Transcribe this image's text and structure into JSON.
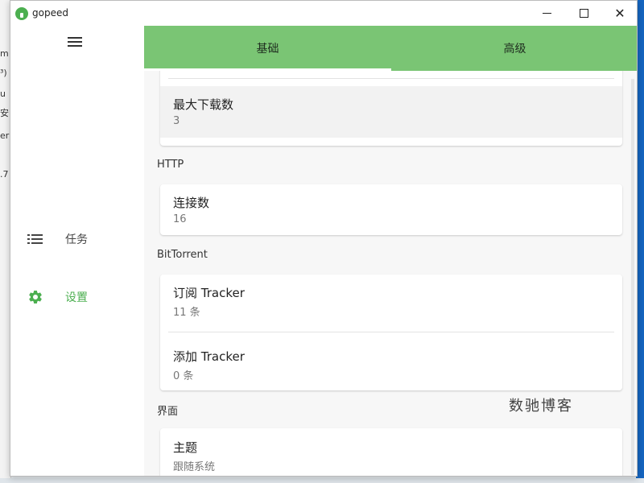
{
  "window": {
    "title": "gopeed"
  },
  "background": {
    "fragments": [
      "m",
      "³)",
      "u",
      "安",
      "er",
      ".7"
    ]
  },
  "sidebar": {
    "items": [
      {
        "label": "任务",
        "icon": "list-icon"
      },
      {
        "label": "设置",
        "icon": "gear-icon",
        "active": true
      }
    ]
  },
  "tabs": [
    {
      "label": "基础",
      "active": true
    },
    {
      "label": "高级",
      "active": false
    }
  ],
  "settings": {
    "general": {
      "max_downloads": {
        "title": "最大下载数",
        "value": "3"
      }
    },
    "http": {
      "section": "HTTP",
      "connections": {
        "title": "连接数",
        "value": "16"
      }
    },
    "bittorrent": {
      "section": "BitTorrent",
      "subscribe_tracker": {
        "title": "订阅 Tracker",
        "value": "11 条"
      },
      "add_tracker": {
        "title": "添加 Tracker",
        "value": "0 条"
      }
    },
    "ui": {
      "section": "界面",
      "theme": {
        "title": "主题",
        "value": "跟随系统"
      }
    }
  },
  "watermark": "数驰博客",
  "colors": {
    "accent": "#7ac574",
    "active_text": "#4caf50"
  }
}
